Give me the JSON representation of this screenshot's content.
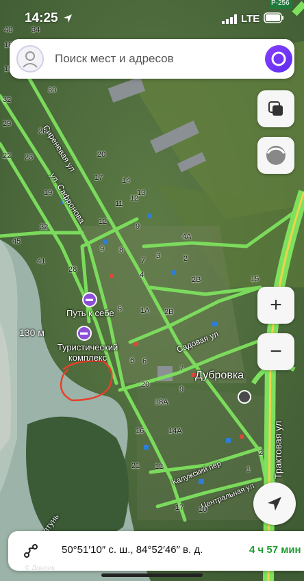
{
  "status": {
    "time": "14:25",
    "network": "LTE",
    "road_badge": "Р-256"
  },
  "search": {
    "placeholder": "Поиск мест и адресов"
  },
  "map": {
    "locality": "Дубровка",
    "scale": "130 м",
    "streets": [
      "Сиреневая ул",
      "ул. Сафронова",
      "Садовая ул",
      "Трактовая ул",
      "Калужский пер",
      "Центральная ул",
      "р. Катунь"
    ],
    "pois": [
      {
        "name": "Путь к себе",
        "icon": "hotel-icon"
      },
      {
        "name": "Туристический комплекс",
        "icon": "hotel-icon"
      }
    ],
    "house_numbers": [
      "40",
      "34",
      "18",
      "15",
      "32",
      "30",
      "29",
      "26",
      "23",
      "22",
      "20",
      "19",
      "17",
      "14",
      "13",
      "12",
      "11",
      "12",
      "9",
      "45",
      "41",
      "32",
      "28",
      "9",
      "8",
      "7",
      "4А",
      "3",
      "2",
      "2В",
      "4",
      "2В",
      "1А",
      "15",
      "6",
      "5",
      "6",
      "20",
      "7",
      "9",
      "18А",
      "16",
      "14А",
      "21",
      "12",
      "17",
      "10",
      "2",
      "1"
    ],
    "annotation": {
      "shape": "circle",
      "color": "#e8402a"
    }
  },
  "controls": {
    "layers": "layers-icon",
    "traffic": "traffic-icon",
    "zoom_in": "+",
    "zoom_out": "−",
    "locate": "locate-arrow-icon"
  },
  "bottom": {
    "coordinates": "50°51′10″ с. ш., 84°52′46″ в. д.",
    "duration": "4 ч 57 мин",
    "route_icon": "route-icon",
    "watermark": "© Донлик"
  }
}
